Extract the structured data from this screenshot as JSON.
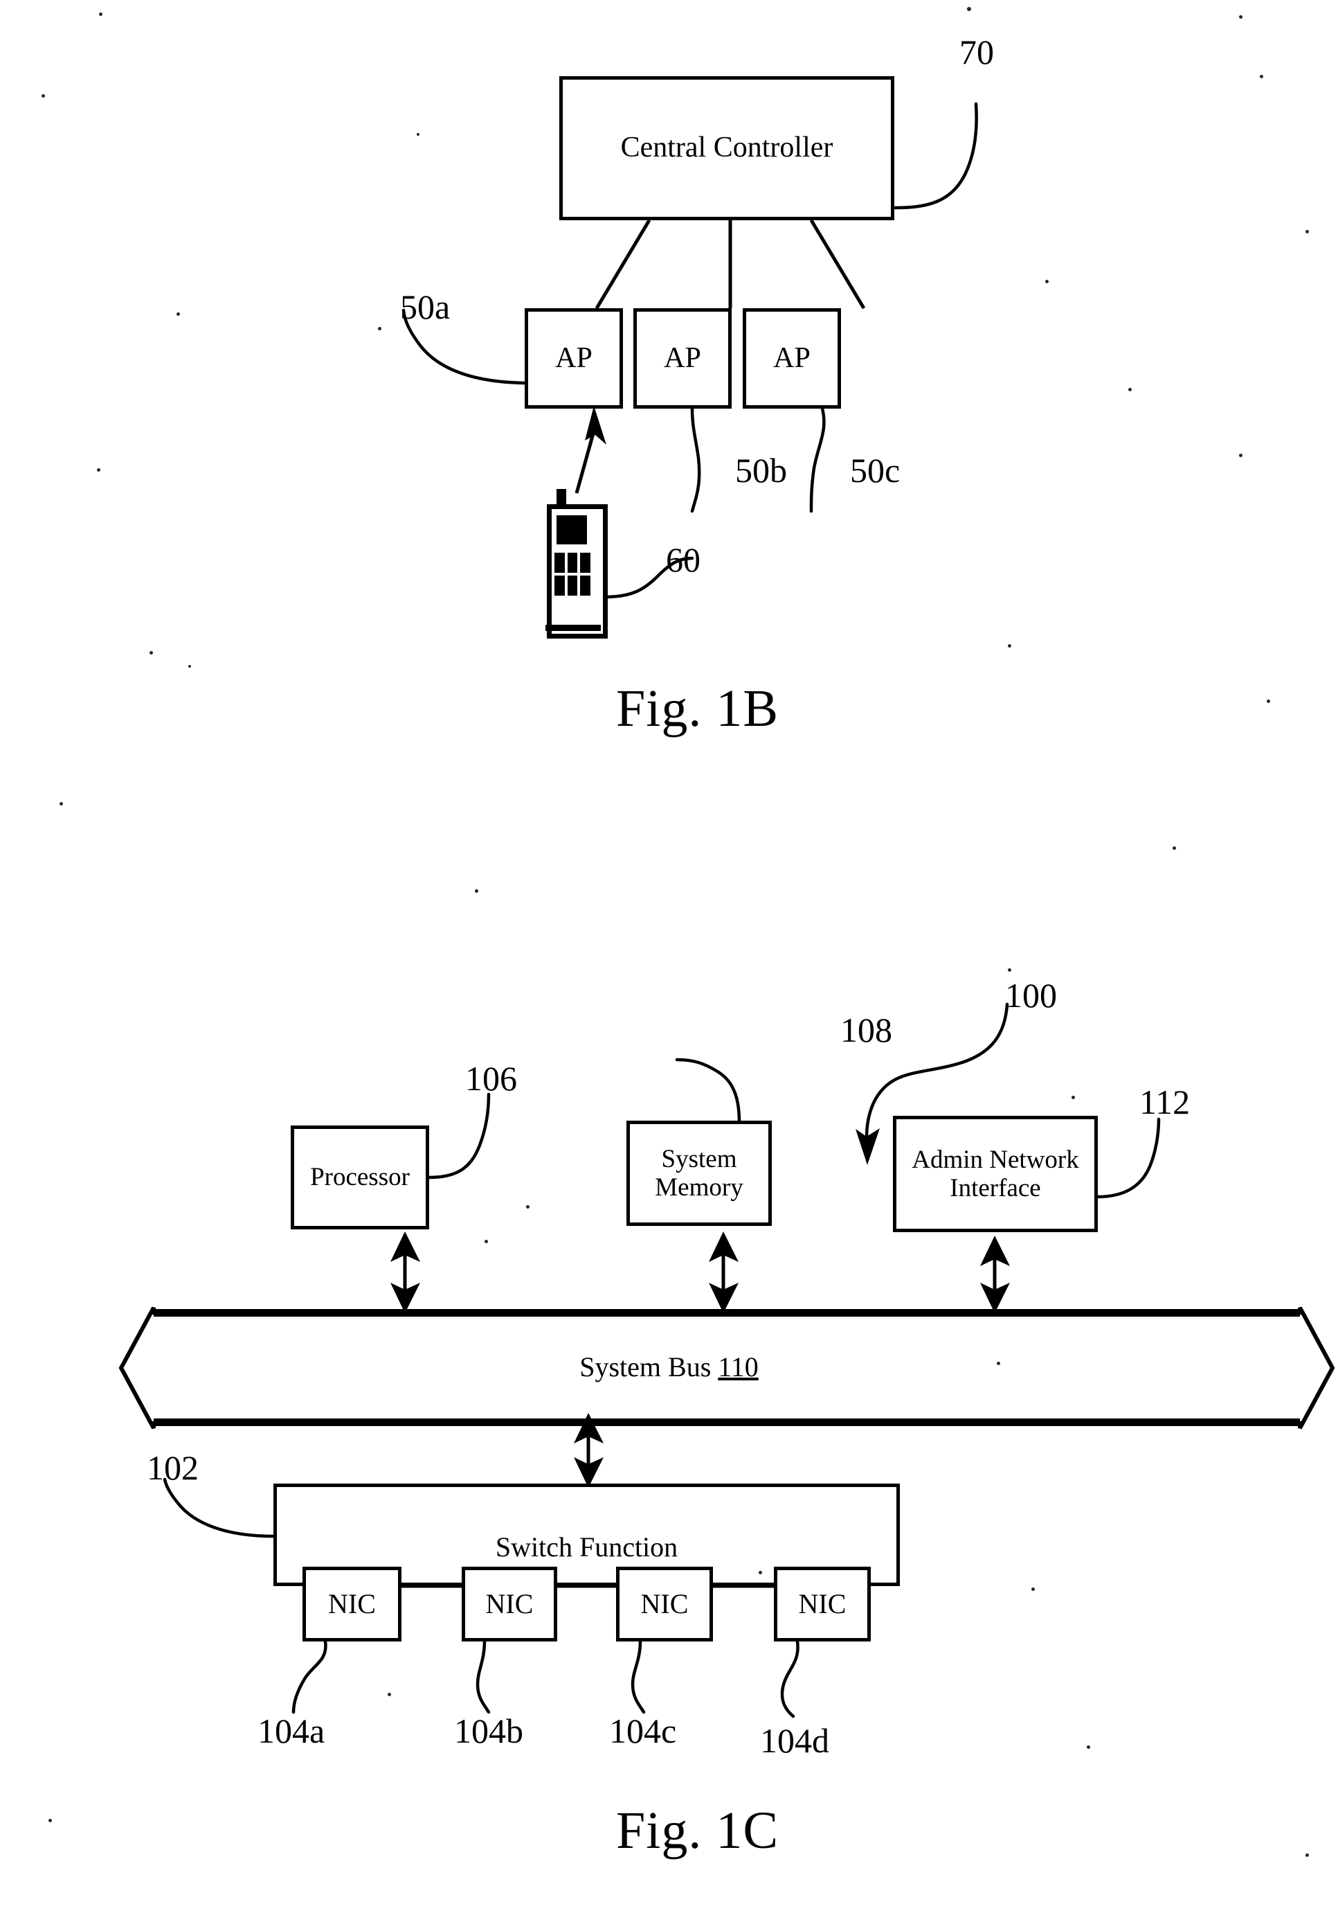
{
  "document": {
    "type": "patent-drawing-sheet",
    "figures": [
      "Fig. 1B",
      "Fig. 1C"
    ]
  },
  "fig1b": {
    "caption": "Fig.  1B",
    "nodes": {
      "central_controller": {
        "label": "Central Controller",
        "ref": "70"
      },
      "ap_a": {
        "label": "AP",
        "ref": "50a"
      },
      "ap_b": {
        "label": "AP",
        "ref": "50b"
      },
      "ap_c": {
        "label": "AP",
        "ref": "50c"
      },
      "mobile_station": {
        "label": "",
        "ref": "60",
        "icon": "mobile-phone-icon"
      }
    },
    "ref_labels": [
      "70",
      "50a",
      "50b",
      "50c",
      "60"
    ]
  },
  "fig1c": {
    "caption": "Fig.  1C",
    "system_ref": "100",
    "nodes": {
      "processor": {
        "label": "Processor",
        "ref": "106"
      },
      "system_memory": {
        "label_line1": "System",
        "label_line2": "Memory",
        "ref": "108"
      },
      "admin_network_interface": {
        "label_line1": "Admin Network",
        "label_line2": "Interface",
        "ref": "112"
      },
      "system_bus": {
        "label": "System Bus ",
        "ref": "110"
      },
      "switch_function": {
        "label": "Switch Function",
        "ref": "102"
      },
      "nics": [
        {
          "label": "NIC",
          "ref": "104a"
        },
        {
          "label": "NIC",
          "ref": "104b"
        },
        {
          "label": "NIC",
          "ref": "104c"
        },
        {
          "label": "NIC",
          "ref": "104d"
        }
      ]
    },
    "ref_labels": [
      "100",
      "102",
      "104a",
      "104b",
      "104c",
      "104d",
      "106",
      "108",
      "110",
      "112"
    ]
  },
  "colors": {
    "ink": "#000000",
    "paper": "#ffffff"
  }
}
